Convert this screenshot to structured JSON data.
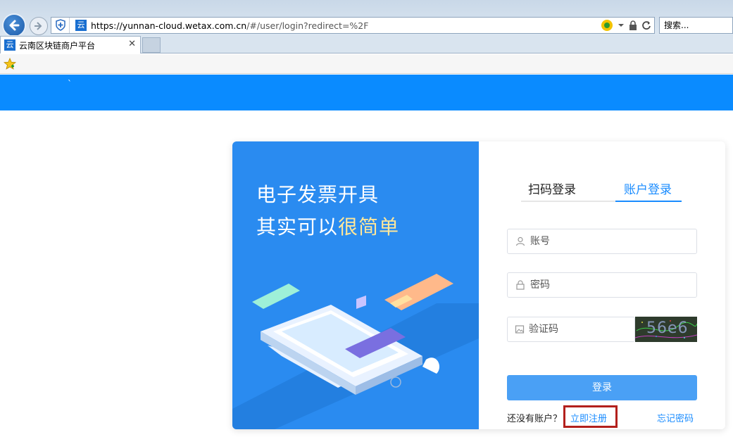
{
  "browser": {
    "url_host": "https://yunnan-cloud.wetax.com.cn",
    "url_rest": "/#/user/login?redirect=%2F",
    "search_placeholder": "搜索...",
    "tab_title": "云南区块链商户平台",
    "tab_close": "✕",
    "favicon_char": "云"
  },
  "header": {
    "mark": "`"
  },
  "promo": {
    "line1": "电子发票开具",
    "line2_prefix": "其实可以",
    "line2_highlight": "很简单",
    "highlight_color": "#ffe79a"
  },
  "login": {
    "tab_qr": "扫码登录",
    "tab_account": "账户登录",
    "username_placeholder": "账号",
    "password_placeholder": "密码",
    "captcha_placeholder": "验证码",
    "captcha_text": "56e6",
    "submit_label": "登录",
    "no_account_text": "还没有账户？",
    "register_label": "立即注册",
    "forgot_label": "忘记密码",
    "accent_color": "#1a8cff"
  }
}
